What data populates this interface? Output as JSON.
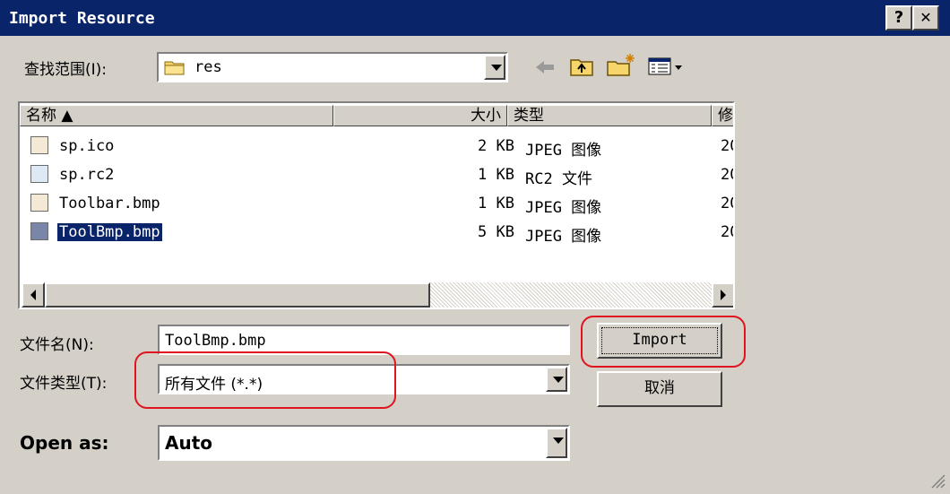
{
  "window": {
    "title": "Import Resource",
    "help_label": "?",
    "close_label": "✕"
  },
  "lookin": {
    "label": "查找范围(I):",
    "value": "res"
  },
  "toolbar": {
    "icons": [
      "back-icon",
      "up-folder-icon",
      "new-folder-icon",
      "view-menu-icon"
    ]
  },
  "list": {
    "columns": [
      "名称 ▲",
      "大小",
      "类型",
      "修改"
    ],
    "rows": [
      {
        "name": "sp.ico",
        "size": "2 KB",
        "type": "JPEG 图像",
        "date": "20",
        "icon": "image-file-icon",
        "selected": false
      },
      {
        "name": "sp.rc2",
        "size": "1 KB",
        "type": "RC2 文件",
        "date": "20",
        "icon": "rc2-file-icon",
        "selected": false
      },
      {
        "name": "Toolbar.bmp",
        "size": "1 KB",
        "type": "JPEG 图像",
        "date": "20",
        "icon": "image-file-icon",
        "selected": false
      },
      {
        "name": "ToolBmp.bmp",
        "size": "5 KB",
        "type": "JPEG 图像",
        "date": "20",
        "icon": "image-file-icon",
        "selected": true
      }
    ]
  },
  "filename": {
    "label": "文件名(N):",
    "value": "ToolBmp.bmp"
  },
  "filetype": {
    "label": "文件类型(T):",
    "value": "所有文件 (*.*)"
  },
  "openas": {
    "label": "Open as:",
    "value": "Auto"
  },
  "buttons": {
    "import": "Import",
    "cancel": "取消"
  },
  "colors": {
    "titlebar": "#0a246a",
    "annotation": "#e0141e",
    "selection": "#0a246a"
  }
}
